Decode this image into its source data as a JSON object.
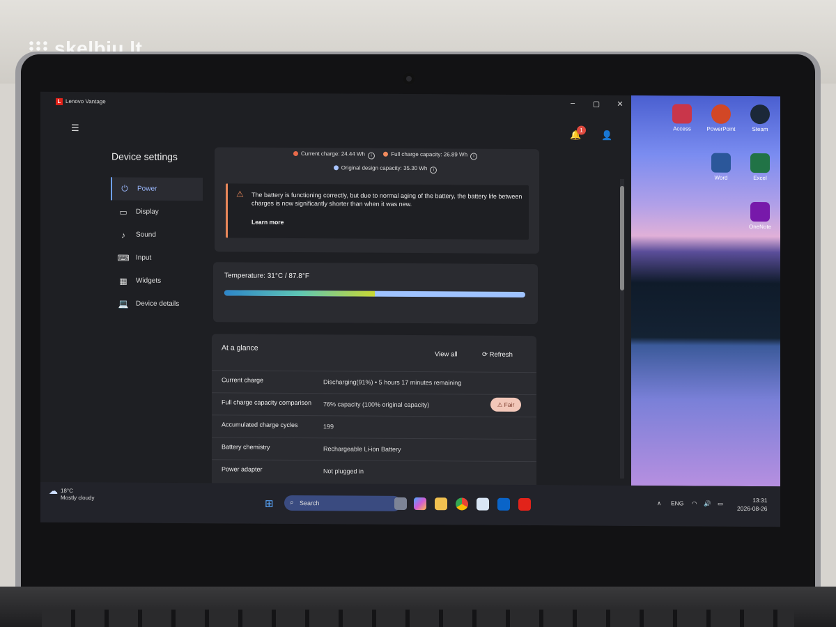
{
  "watermark": "skelbiu.lt",
  "window": {
    "title": "Lenovo Vantage",
    "logo": "L",
    "minimize": "–",
    "maximize": "▢",
    "close": "✕",
    "notification_count": "1"
  },
  "sidebar": {
    "title": "Device settings",
    "items": [
      {
        "label": "Power",
        "icon": "plug-icon"
      },
      {
        "label": "Display",
        "icon": "monitor-icon"
      },
      {
        "label": "Sound",
        "icon": "music-note-icon"
      },
      {
        "label": "Input",
        "icon": "keyboard-icon"
      },
      {
        "label": "Widgets",
        "icon": "widgets-icon"
      },
      {
        "label": "Device details",
        "icon": "laptop-icon"
      }
    ]
  },
  "battery": {
    "current_charge": "Current charge:  24.44 Wh",
    "full_charge": "Full charge capacity:  26.89 Wh",
    "design_capacity": "Original design capacity:  35.30 Wh",
    "warning": "The battery is functioning correctly, but due to normal aging of the battery, the battery life between charges is now significantly shorter than when it was new.",
    "learn_more": "Learn more"
  },
  "temperature": {
    "label": "Temperature:  31°C / 87.8°F"
  },
  "glance": {
    "title": "At a glance",
    "view_all": "View all",
    "refresh": "Refresh",
    "rows": [
      {
        "label": "Current charge",
        "value": "Discharging(91%)  •  5 hours 17 minutes remaining"
      },
      {
        "label": "Full charge capacity comparison",
        "value": "76% capacity (100% original capacity)",
        "badge": "Fair"
      },
      {
        "label": "Accumulated charge cycles",
        "value": "199"
      },
      {
        "label": "Battery chemistry",
        "value": "Rechargeable Li-ion Battery"
      },
      {
        "label": "Power adapter",
        "value": "Not plugged in"
      }
    ]
  },
  "desktop": {
    "icons": [
      {
        "label": "Access",
        "color": "#c9364a"
      },
      {
        "label": "PowerPoint",
        "color": "#d24726"
      },
      {
        "label": "Steam",
        "color": "#1b2838"
      },
      {
        "label": "Word",
        "color": "#2b579a"
      },
      {
        "label": "Excel",
        "color": "#217346"
      },
      {
        "label": "OneNote",
        "color": "#7719aa"
      }
    ]
  },
  "taskbar": {
    "weather_temp": "18°C",
    "weather_desc": "Mostly cloudy",
    "search_placeholder": "Search",
    "language": "ENG",
    "time": "13:31",
    "date": "2026-08-26"
  },
  "colors": {
    "accent": "#6ea0ff",
    "warning": "#e8875a",
    "current_dot": "#e86a4a",
    "full_dot": "#f08a5d",
    "design_dot": "#a8c4ff"
  }
}
